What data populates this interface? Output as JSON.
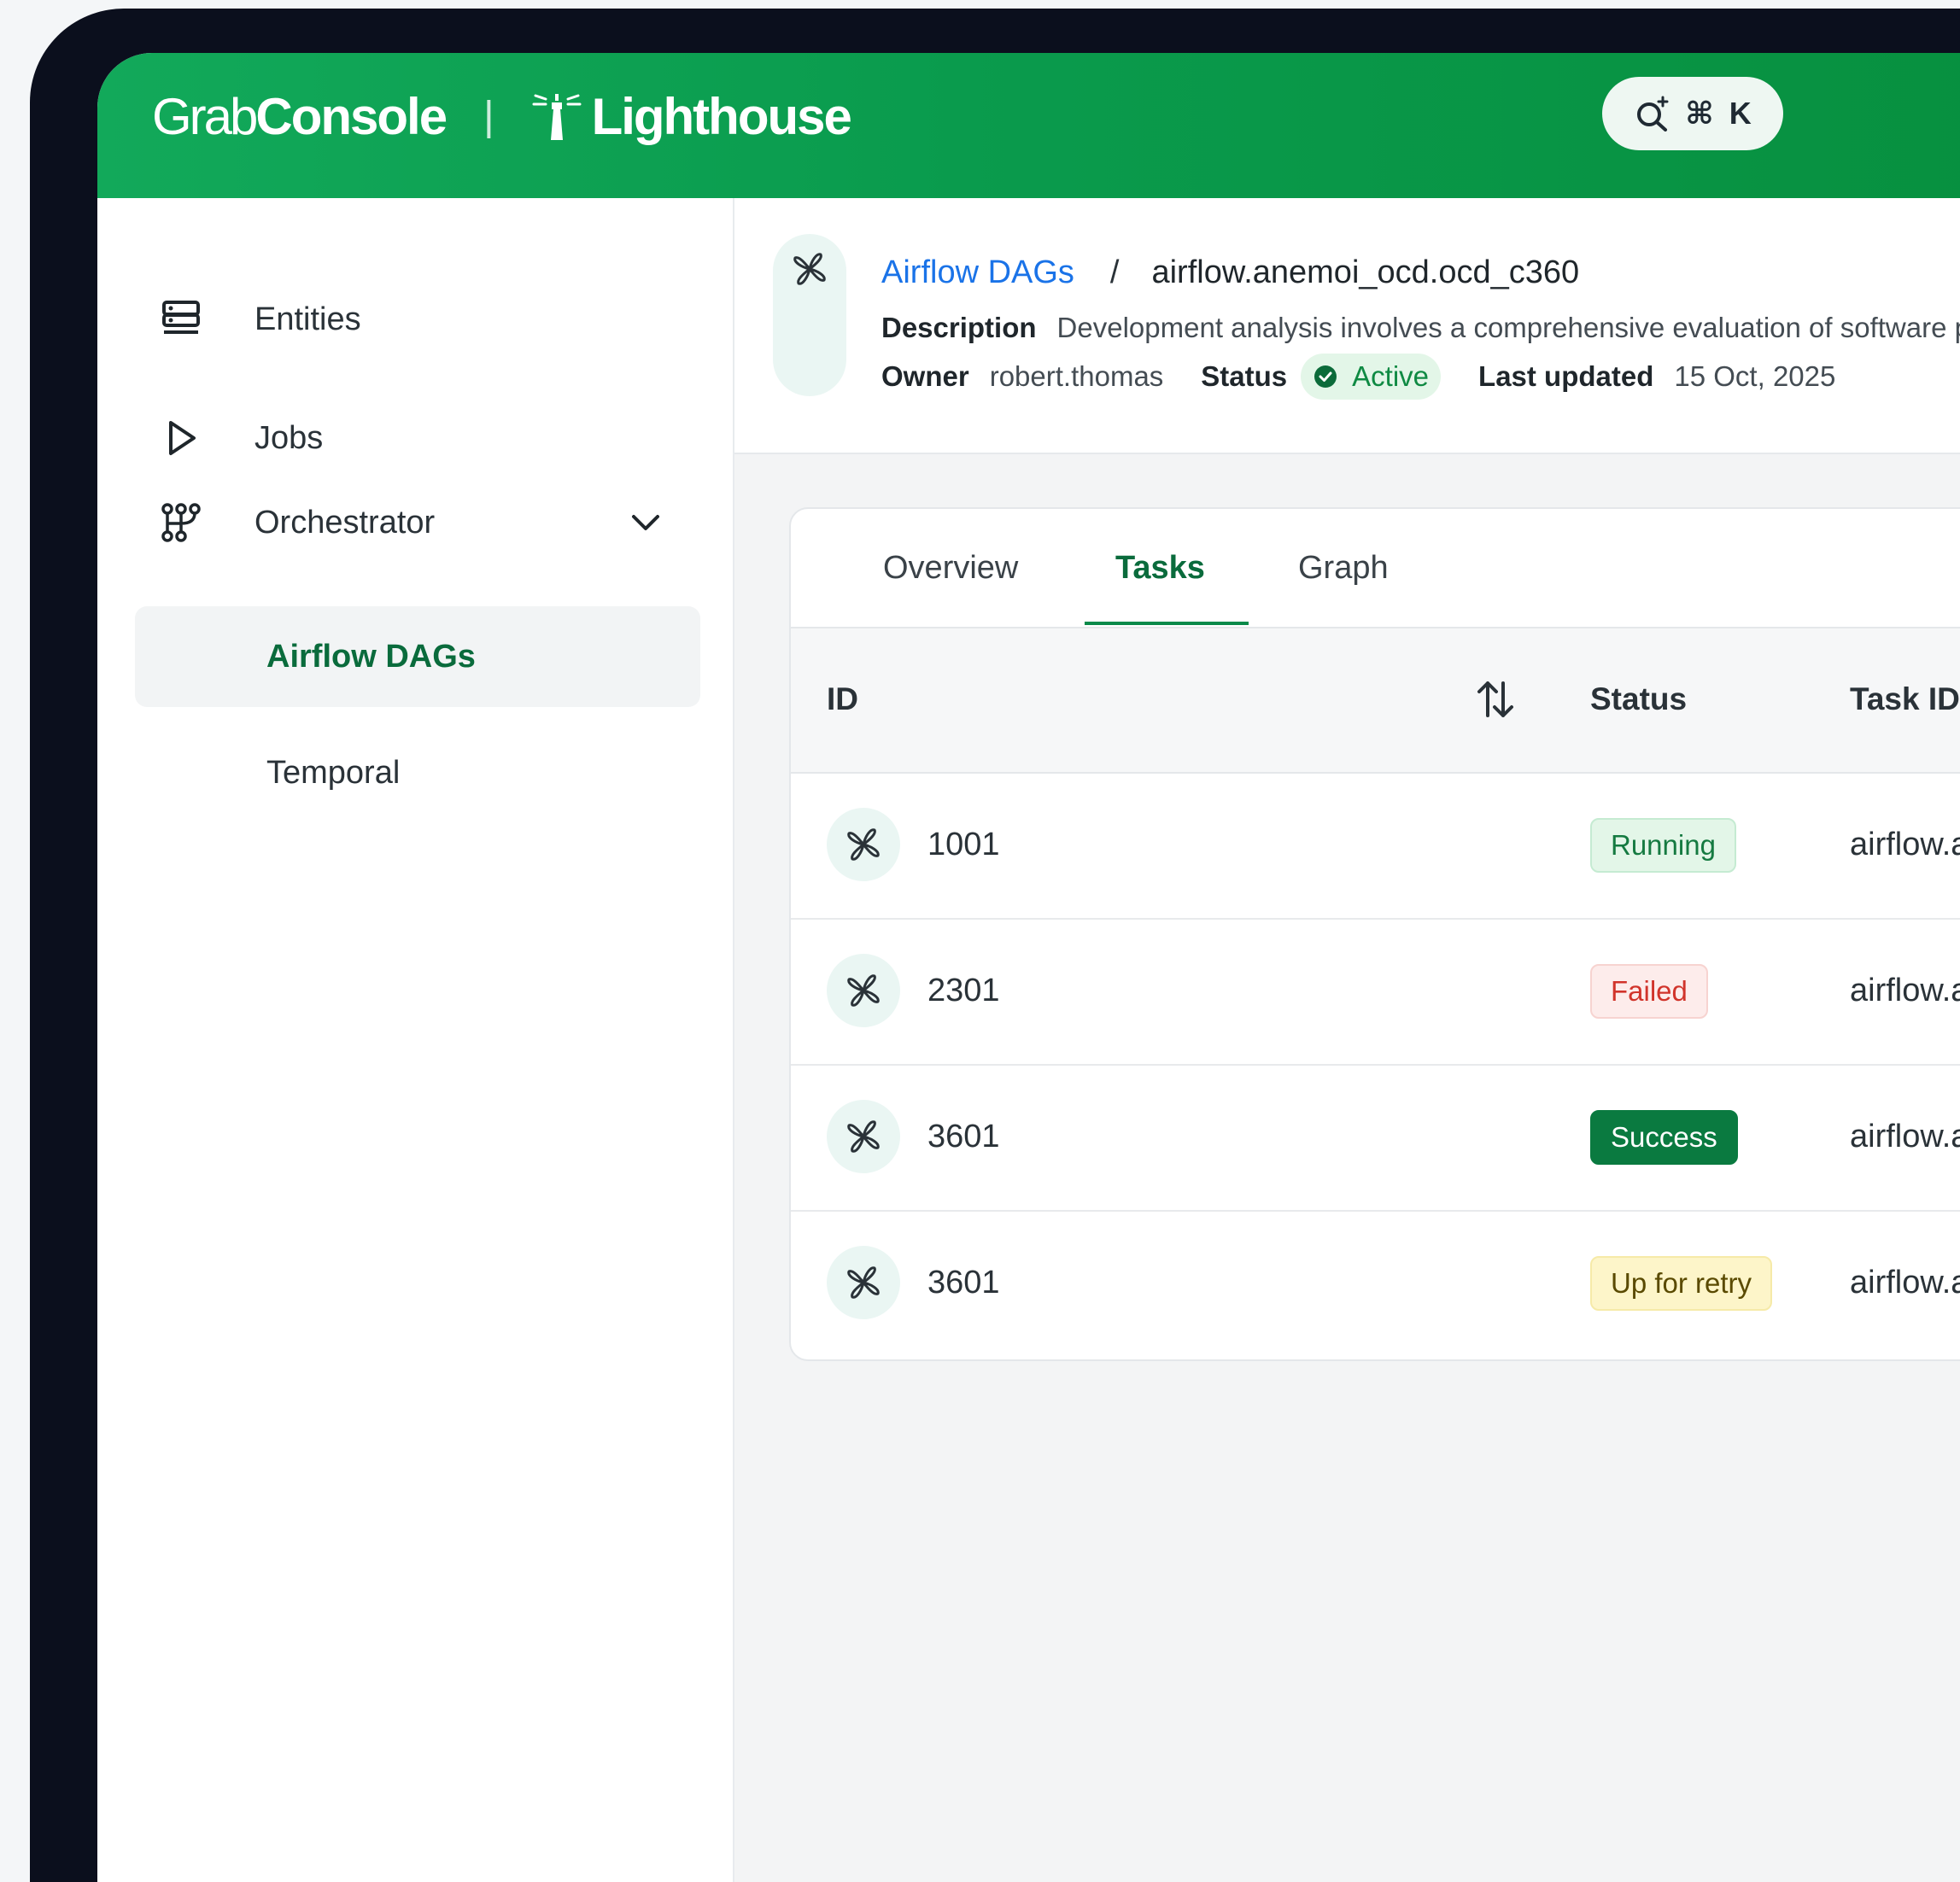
{
  "brand": {
    "grab": "Grab",
    "console": "Console",
    "separator": "|",
    "product": "Lighthouse",
    "primary_color": "#0a9b4d"
  },
  "search": {
    "shortcut_symbol": "⌘",
    "shortcut_key": "K"
  },
  "sidebar": {
    "items": [
      {
        "label": "Entities",
        "icon": "server-stack-icon"
      },
      {
        "label": "Jobs",
        "icon": "play-icon"
      },
      {
        "label": "Orchestrator",
        "icon": "workflow-icon",
        "expanded": true
      }
    ],
    "sub_items": [
      {
        "label": "Airflow DAGs",
        "active": true
      },
      {
        "label": "Temporal",
        "active": false
      }
    ]
  },
  "header": {
    "breadcrumb_parent": "Airflow DAGs",
    "breadcrumb_sep": "/",
    "breadcrumb_current": "airflow.anemoi_ocd.ocd_c360",
    "description_label": "Description",
    "description_text": "Development analysis involves a comprehensive evaluation of software p",
    "owner_label": "Owner",
    "owner_value": "robert.thomas",
    "status_label": "Status",
    "status_value": "Active",
    "updated_label": "Last updated",
    "updated_value": "15 Oct, 2025"
  },
  "tabs": [
    {
      "label": "Overview",
      "active": false
    },
    {
      "label": "Tasks",
      "active": true
    },
    {
      "label": "Graph",
      "active": false
    }
  ],
  "table": {
    "columns": [
      "ID",
      "Status",
      "Task ID"
    ],
    "rows": [
      {
        "id": "1001",
        "status": "Running",
        "task_id": "airflow.an"
      },
      {
        "id": "2301",
        "status": "Failed",
        "task_id": "airflow.an"
      },
      {
        "id": "3601",
        "status": "Success",
        "task_id": "airflow.an"
      },
      {
        "id": "3601",
        "status": "Up for retry",
        "task_id": "airflow.an"
      }
    ]
  },
  "colors": {
    "running": "#157a41",
    "failed": "#d1342b",
    "success": "#0a7a40",
    "retry": "#5a4a00",
    "link": "#1a73e8"
  }
}
